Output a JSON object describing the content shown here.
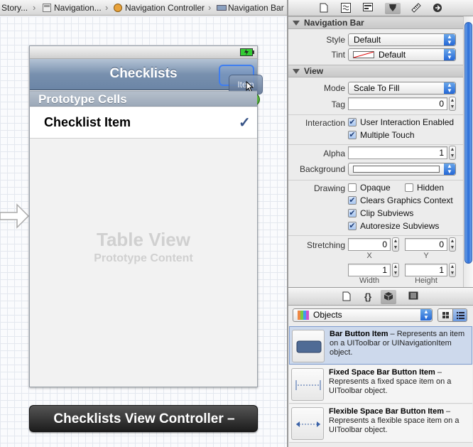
{
  "breadcrumb": {
    "items": [
      "Story...",
      "Navigation...",
      "Navigation Controller",
      "Navigation Bar"
    ]
  },
  "canvas": {
    "nav_title": "Checklists",
    "drag_item": "Item",
    "plus": "+",
    "section_title": "Prototype Cells",
    "cell_text": "Checklist Item",
    "checkmark": "✓",
    "table_view_title": "Table View",
    "table_view_subtitle": "Prototype Content",
    "controller_label": "Checklists View Controller –"
  },
  "inspector": {
    "nav_section": "Navigation Bar",
    "style_label": "Style",
    "style_value": "Default",
    "tint_label": "Tint",
    "tint_value": "Default",
    "view_section": "View",
    "mode_label": "Mode",
    "mode_value": "Scale To Fill",
    "tag_label": "Tag",
    "tag_value": "0",
    "interaction_label": "Interaction",
    "user_interaction": "User Interaction Enabled",
    "multiple_touch": "Multiple Touch",
    "alpha_label": "Alpha",
    "alpha_value": "1",
    "background_label": "Background",
    "drawing_label": "Drawing",
    "opaque": "Opaque",
    "hidden": "Hidden",
    "clears_graphics": "Clears Graphics Context",
    "clip_subviews": "Clip Subviews",
    "autoresize": "Autoresize Subviews",
    "stretching_label": "Stretching",
    "x_value": "0",
    "y_value": "0",
    "x_label": "X",
    "y_label": "Y",
    "width_value": "1",
    "height_value": "1",
    "width_label": "Width",
    "height_label": "Height"
  },
  "checkbox_states": {
    "user_interaction": true,
    "multiple_touch": true,
    "opaque": false,
    "hidden": false,
    "clears_graphics": true,
    "clip_subviews": true,
    "autoresize": true
  },
  "library": {
    "tab_braces": "{}",
    "filter_value": "Objects",
    "items": [
      {
        "title": "Bar Button Item",
        "desc": " – Represents an item on a UIToolbar or UINavigationItem object."
      },
      {
        "title": "Fixed Space Bar Button Item",
        "desc": " – Represents a fixed space item on a UIToolbar object."
      },
      {
        "title": "Flexible Space Bar Button Item",
        "desc": " – Represents a flexible space item on a UIToolbar object."
      }
    ]
  },
  "colors": {
    "accent": "#2d6ed8",
    "navbar": "#7890ae",
    "selection": "#cdd9ec"
  }
}
